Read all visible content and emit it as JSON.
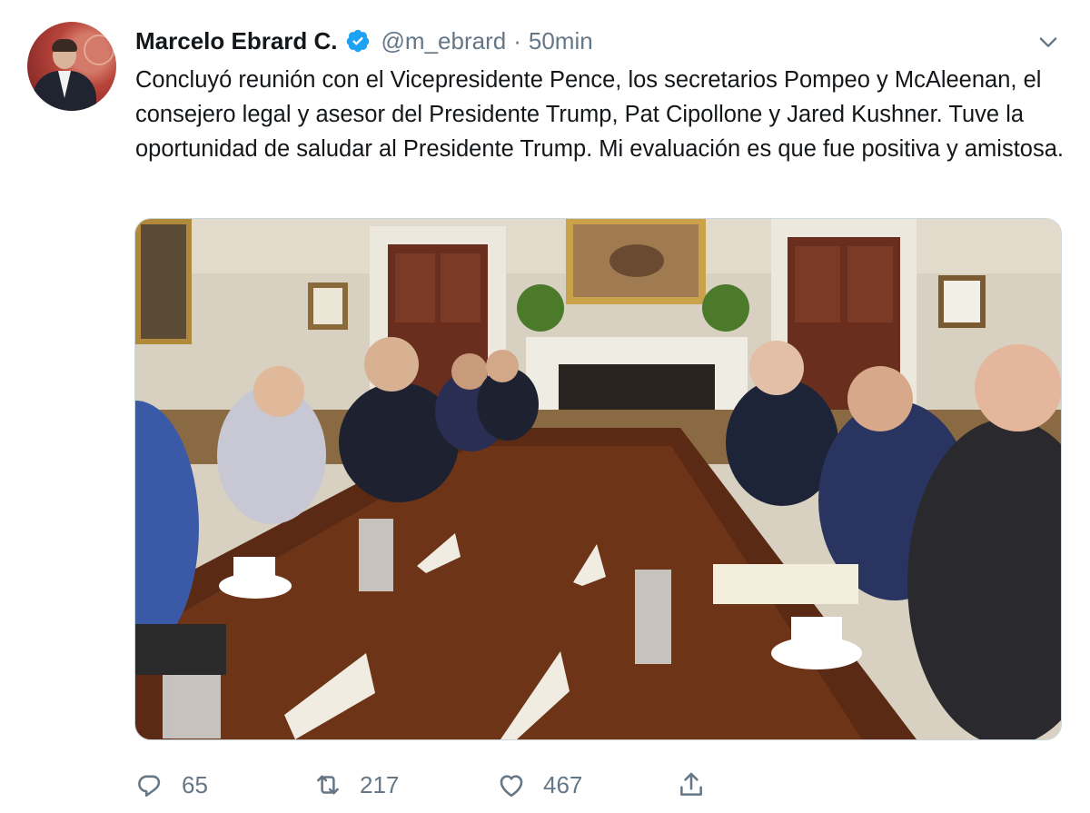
{
  "tweet": {
    "author_name": "Marcelo Ebrard C.",
    "handle": "@m_ebrard",
    "separator": "·",
    "time": "50min",
    "text": "Concluyó reunión con el Vicepresidente Pence, los secretarios Pompeo y McAleenan, el consejero legal y asesor del Presidente Trump, Pat Cipollone y Jared Kushner. Tuve la oportunidad de saludar al Presidente Trump. Mi evaluación es que fue positiva y amistosa."
  },
  "actions": {
    "replies": "65",
    "retweets": "217",
    "likes": "467"
  },
  "colors": {
    "verified": "#1da1f2",
    "secondary_text": "#657786"
  },
  "icons": {
    "verified": "verified-badge-icon",
    "menu": "chevron-down-icon",
    "reply": "reply-icon",
    "retweet": "retweet-icon",
    "like": "heart-icon",
    "share": "share-icon"
  }
}
